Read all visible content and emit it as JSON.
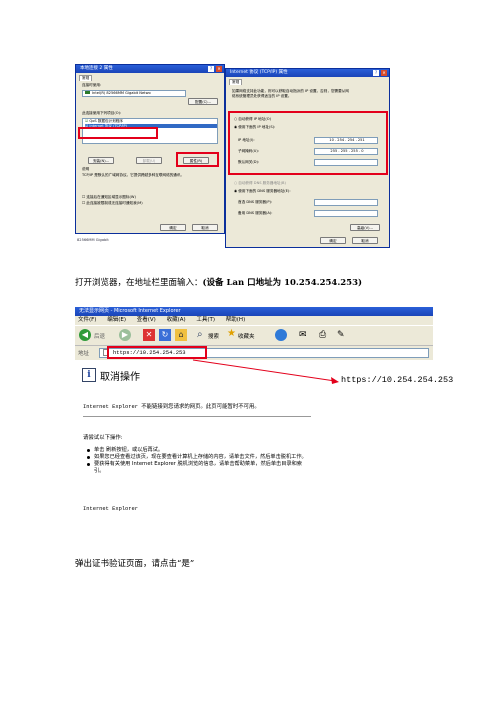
{
  "screenshot1": {
    "left_dialog": {
      "title": "本地连接 2 属性",
      "tab": "常规",
      "connect_using_label": "连接时使用:",
      "adapter": "Intel(R) 82566MM Gigabit Netwo",
      "config_button": "配置(C)...",
      "items_label": "此连接使用下列项目(O):",
      "items": [
        "QoS 数据包计划程序",
        "Internet 协议 (TCP/IP)"
      ],
      "install_button": "安装(N)...",
      "uninstall_button": "卸载(U)",
      "properties_button": "属性(R)",
      "description_title": "说明",
      "description": "TCP/IP 是默认的广域网协议。它提供跨越多种互联网络的通讯。",
      "checkbox1": "连接后在通知区域显示图标(W)",
      "checkbox2": "此连接被限制或无连接时通知我(M)",
      "ok_button": "确定",
      "cancel_button": "取消",
      "bottom_text": "82566MM Gigabit"
    },
    "right_dialog": {
      "title": "Internet 协议 (TCP/IP) 属性",
      "tab": "常规",
      "intro": "如果网络支持此功能，则可以获取自动指派的 IP 设置。否则，您需要从网络系统管理员处获得适当的 IP 设置。",
      "auto_ip": "自动获得 IP 地址(O)",
      "use_ip": "使用下面的 IP 地址(S):",
      "ip_label": "IP 地址(I):",
      "ip_value": "10 . 254 . 254 . 251",
      "mask_label": "子网掩码(U):",
      "mask_value": "255 . 255 . 255 . 0",
      "gateway_label": "默认网关(D):",
      "auto_dns": "自动获得 DNS 服务器地址(B)",
      "use_dns": "使用下面的 DNS 服务器地址(E):",
      "dns1_label": "首选 DNS 服务器(P):",
      "dns2_label": "备用 DNS 服务器(A):",
      "advanced_button": "高级(V)...",
      "ok_button": "确定",
      "cancel_button": "取消"
    }
  },
  "para1": {
    "text": "打开浏览器，在地址栏里面输入：",
    "bold": "(设备 Lan 口地址为 10.254.254.253)"
  },
  "screenshot2": {
    "title": "无法显示网页 - Microsoft Internet Explorer",
    "menu": [
      "文件(F)",
      "编辑(E)",
      "查看(V)",
      "收藏(A)",
      "工具(T)",
      "帮助(H)"
    ],
    "back": "后退",
    "search": "搜索",
    "favorites": "收藏夹",
    "address_label": "地址",
    "address_value": "https://10.254.254.253",
    "page_heading": "取消操作",
    "callout": "https://10.254.254.253",
    "error_line": "Internet Explorer 不能链接到您请求的网页。此页可能暂时不可用。",
    "try_label": "请尝试以下操作:",
    "bullets": [
      "单击 刷新按钮，或以后再试。",
      "如果您已经查看过该页，现在要查看计算机上存储的内容，请单击文件，然后单击脱机工作。",
      "要获得有关使用 Internet Explorer 脱机浏览的信息，请单击帮助菜单，然后单击目录和索引。"
    ],
    "footer": "Internet Explorer"
  },
  "para2": {
    "text": "弹出证书验证页面，请点击“是”"
  },
  "colors": {
    "red": "#e3001b",
    "xp_blue": "#1a44b8",
    "dialog_bg": "#ece9d8"
  }
}
